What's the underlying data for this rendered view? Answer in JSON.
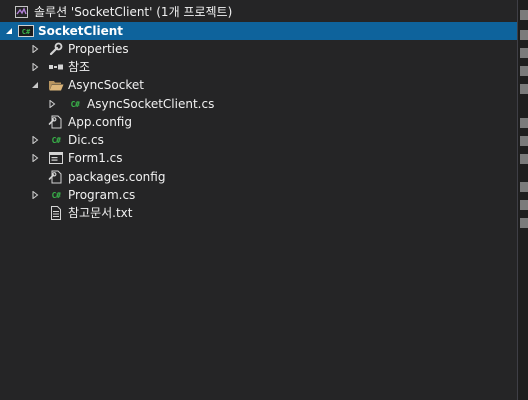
{
  "solution_explorer": {
    "solution_label": "솔루션 'SocketClient' (1개 프로젝트)",
    "project_label": "SocketClient",
    "items": [
      {
        "label": "Properties",
        "icon": "wrench-icon"
      },
      {
        "label": "참조",
        "icon": "references-icon"
      },
      {
        "label": "AsyncSocket",
        "icon": "folder-open-icon"
      },
      {
        "label": "AsyncSocketClient.cs",
        "icon": "csharp-file-icon"
      },
      {
        "label": "App.config",
        "icon": "config-file-icon"
      },
      {
        "label": "Dic.cs",
        "icon": "csharp-file-icon"
      },
      {
        "label": "Form1.cs",
        "icon": "form-icon"
      },
      {
        "label": "packages.config",
        "icon": "config-file-icon"
      },
      {
        "label": "Program.cs",
        "icon": "csharp-file-icon"
      },
      {
        "label": "참고문서.txt",
        "icon": "text-file-icon"
      }
    ],
    "csharp_badge": "C#"
  },
  "colors": {
    "background": "#252526",
    "selection": "#0e639c",
    "csharp_green": "#39b54a",
    "folder_tan": "#dcb67a"
  }
}
